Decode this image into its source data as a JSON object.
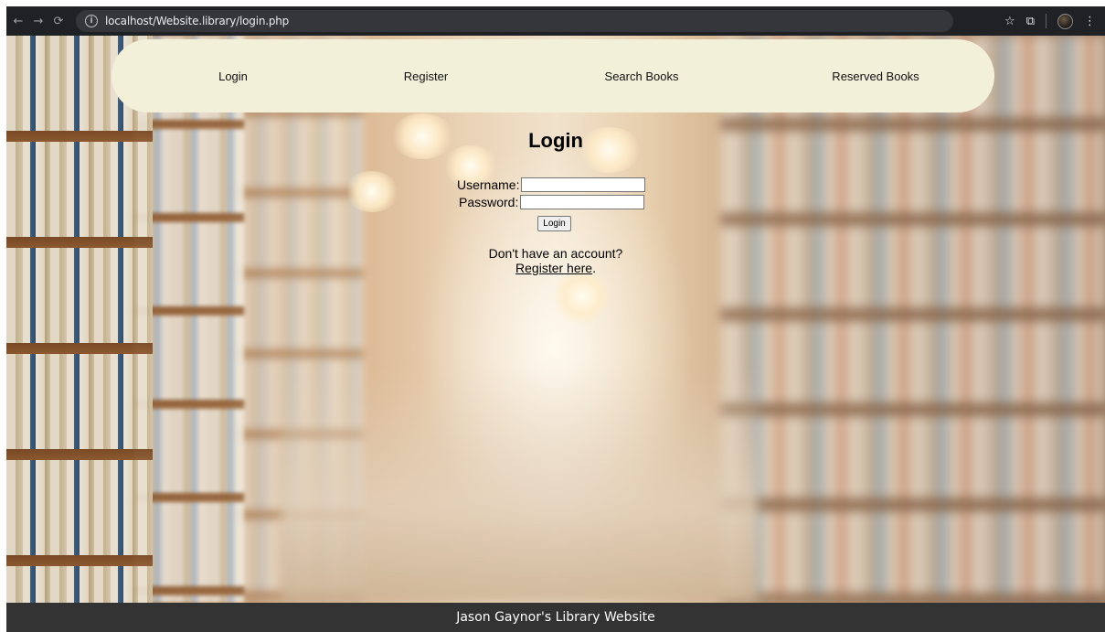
{
  "browser": {
    "url": "localhost/Website.library/login.php",
    "icons": {
      "back": "arrow-left-icon",
      "forward": "arrow-right-icon",
      "reload": "reload-icon",
      "site_info": "info-icon",
      "bookmark": "star-icon",
      "extensions": "puzzle-icon",
      "profile": "avatar",
      "menu": "kebab-menu-icon"
    }
  },
  "nav": {
    "items": [
      {
        "label": "Login"
      },
      {
        "label": "Register"
      },
      {
        "label": "Search Books"
      },
      {
        "label": "Reserved Books"
      }
    ],
    "background": "#f3f0da"
  },
  "login": {
    "title": "Login",
    "username_label": "Username:",
    "username_value": "",
    "password_label": "Password:",
    "password_value": "",
    "submit_label": "Login",
    "no_account_text": "Don't have an account?",
    "register_link": "Register here",
    "register_suffix": "."
  },
  "footer": {
    "text": "Jason Gaynor's Library Website",
    "background": "#333333"
  }
}
